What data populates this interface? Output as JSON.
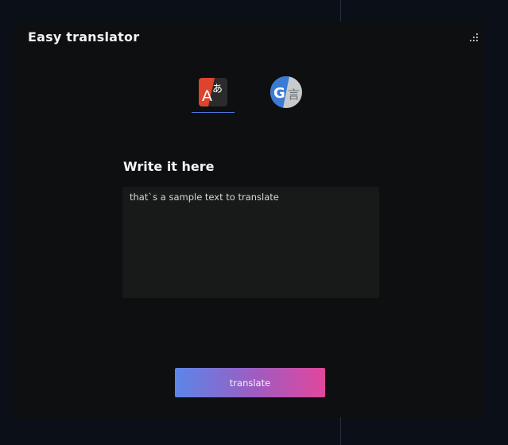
{
  "app": {
    "title": "Easy translator"
  },
  "services": [
    {
      "name": "translate-service",
      "icon": "translate-app-icon",
      "active": true
    },
    {
      "name": "google-translate-service",
      "icon": "google-translate-icon",
      "active": false
    }
  ],
  "editor": {
    "heading": "Write it here",
    "value": "that`s a sample text to translate"
  },
  "actions": {
    "translate_label": "translate"
  },
  "colors": {
    "background": "#0b0f17",
    "panel": "#0e0f10",
    "input_bg": "#181919",
    "tab_underline": "#4a78e0",
    "button_gradient_start": "#5b86e8",
    "button_gradient_end": "#e2479c"
  }
}
